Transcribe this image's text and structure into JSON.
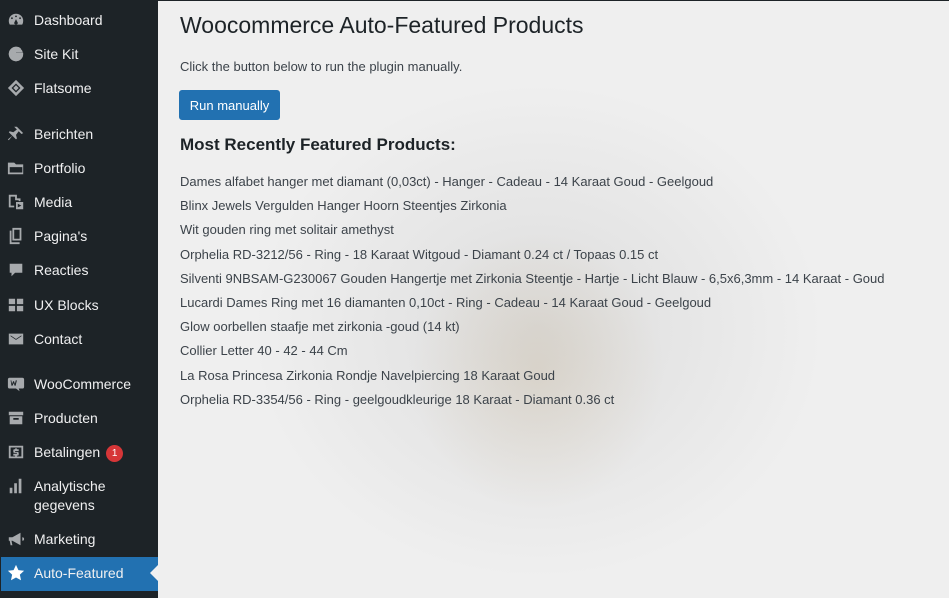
{
  "sidebar": {
    "items": [
      {
        "label": "Dashboard",
        "icon": "dashboard-icon"
      },
      {
        "label": "Site Kit",
        "icon": "google-g-icon"
      },
      {
        "label": "Flatsome",
        "icon": "flatsome-icon"
      },
      {
        "label": "Berichten",
        "icon": "pin-icon"
      },
      {
        "label": "Portfolio",
        "icon": "folder-icon"
      },
      {
        "label": "Media",
        "icon": "media-icon"
      },
      {
        "label": "Pagina's",
        "icon": "pages-icon"
      },
      {
        "label": "Reacties",
        "icon": "comment-icon"
      },
      {
        "label": "UX Blocks",
        "icon": "grid-icon"
      },
      {
        "label": "Contact",
        "icon": "envelope-icon"
      },
      {
        "label": "WooCommerce",
        "icon": "woocommerce-icon"
      },
      {
        "label": "Producten",
        "icon": "archive-icon"
      },
      {
        "label": "Betalingen",
        "icon": "dollar-icon",
        "badge": "1"
      },
      {
        "label": "Analytische gegevens",
        "icon": "bar-chart-icon"
      },
      {
        "label": "Marketing",
        "icon": "megaphone-icon"
      },
      {
        "label": "Auto-Featured",
        "icon": "star-icon",
        "active": true
      }
    ]
  },
  "main": {
    "title": "Woocommerce Auto-Featured Products",
    "intro": "Click the button below to run the plugin manually.",
    "run_button": "Run manually",
    "section_title": "Most Recently Featured Products:",
    "products": [
      "Dames alfabet hanger met diamant (0,03ct) - Hanger - Cadeau - 14 Karaat Goud - Geelgoud",
      "Blinx Jewels Vergulden Hanger Hoorn Steentjes Zirkonia",
      "Wit gouden ring met solitair amethyst",
      "Orphelia RD-3212/56 - Ring - 18 Karaat Witgoud - Diamant 0.24 ct / Topaas 0.15 ct",
      "Silventi 9NBSAM-G230067 Gouden Hangertje met Zirkonia Steentje - Hartje - Licht Blauw - 6,5x6,3mm - 14 Karaat - Goud",
      "Lucardi Dames Ring met 16 diamanten 0,10ct - Ring - Cadeau - 14 Karaat Goud - Geelgoud",
      "Glow oorbellen staafje met zirkonia -goud (14 kt)",
      "Collier Letter 40 - 42 - 44 Cm",
      "La Rosa Princesa Zirkonia Rondje Navelpiercing 18 Karaat Goud",
      "Orphelia RD-3354/56 - Ring - geelgoudkleurige 18 Karaat - Diamant 0.36 ct"
    ]
  },
  "colors": {
    "sidebar_bg": "#1d2327",
    "accent": "#2271b1",
    "badge": "#d63638"
  }
}
